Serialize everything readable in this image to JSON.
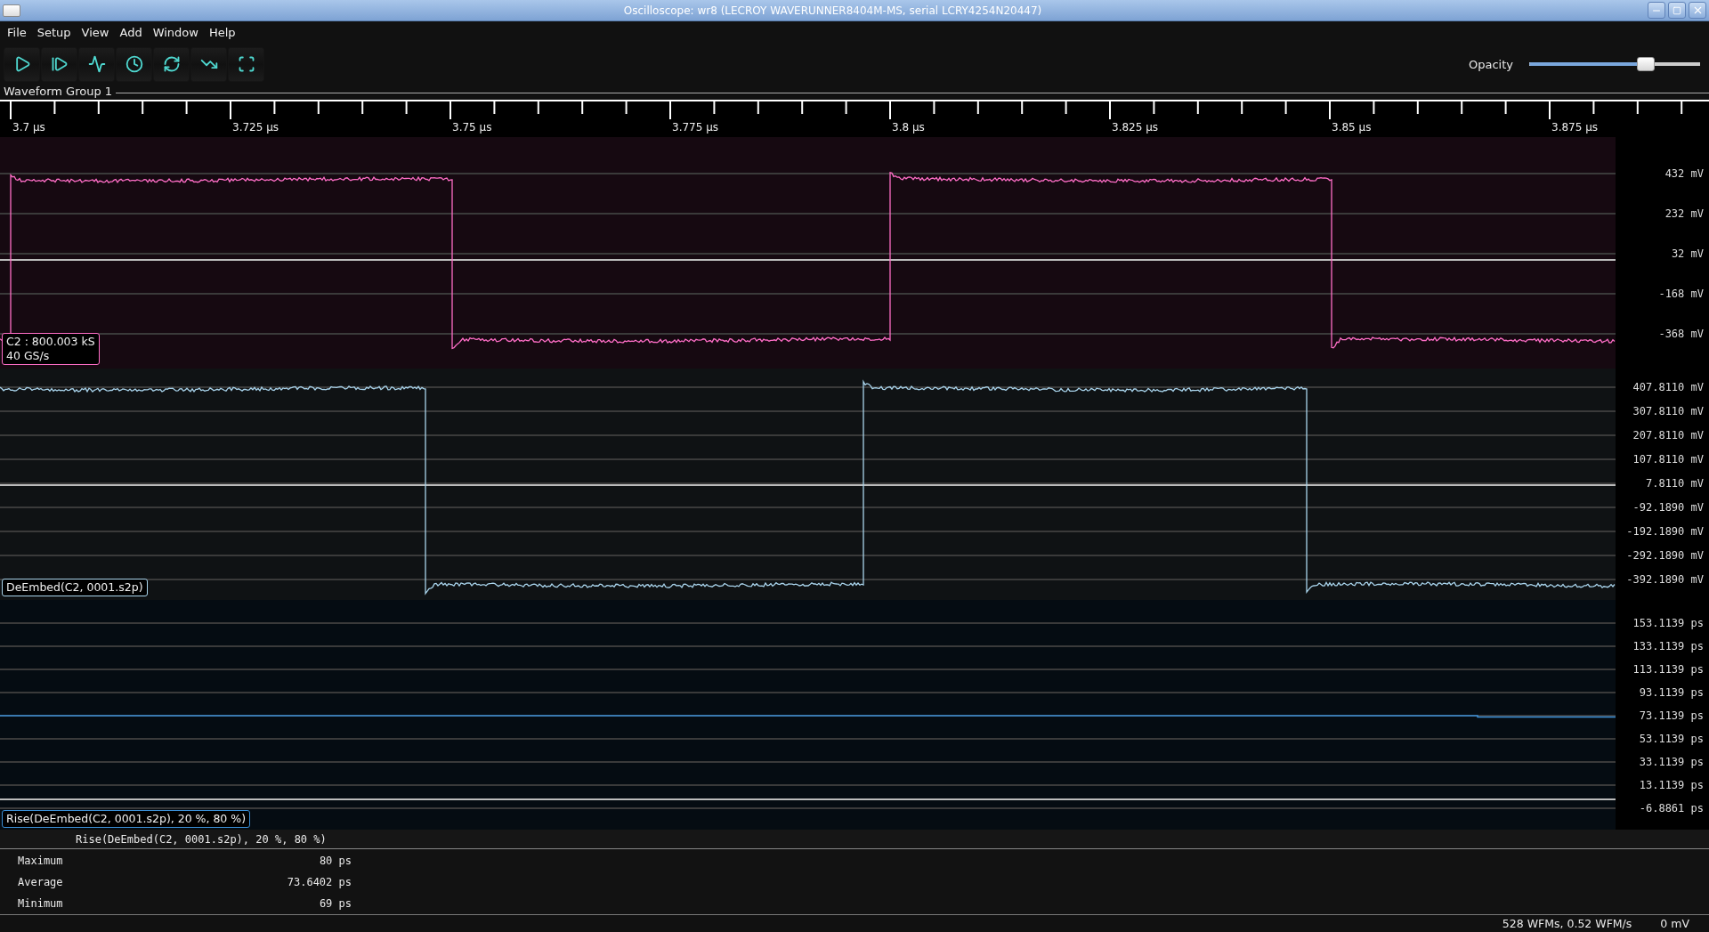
{
  "window": {
    "title": "Oscilloscope: wr8 (LECROY WAVERUNNER8404M-MS, serial LCRY4254N20447)"
  },
  "menu": [
    "File",
    "Setup",
    "View",
    "Add",
    "Window",
    "Help"
  ],
  "opacity": {
    "label": "Opacity",
    "level": 0.68
  },
  "group": {
    "title": "Waveform Group 1",
    "time_ticks": [
      "3.7 µs",
      "3.725 µs",
      "3.75 µs",
      "3.775 µs",
      "3.8 µs",
      "3.825 µs",
      "3.85 µs",
      "3.875 µs"
    ]
  },
  "panels": [
    {
      "kind": "square",
      "color": "#ff6ec7",
      "labels": [
        "C2 : 800.003 kS",
        "40 GS/s"
      ],
      "axis_labels": [
        "432 mV",
        "232 mV",
        "32 mV",
        "-168 mV",
        "-368 mV"
      ]
    },
    {
      "kind": "square_late",
      "color": "#a9d4ec",
      "labels": [
        "DeEmbed(C2, 0001.s2p)"
      ],
      "axis_labels": [
        "407.8110 mV",
        "307.8110 mV",
        "207.8110 mV",
        "107.8110 mV",
        "7.8110 mV",
        "-92.1890 mV",
        "-192.1890 mV",
        "-292.1890 mV",
        "-392.1890 mV"
      ]
    },
    {
      "kind": "trend",
      "color": "#3b8fd6",
      "labels": [
        "Rise(DeEmbed(C2, 0001.s2p), 20 %, 80 %)"
      ],
      "axis_labels": [
        "153.1139 ps",
        "133.1139 ps",
        "113.1139 ps",
        "93.1139 ps",
        "73.1139 ps",
        "53.1139 ps",
        "33.1139 ps",
        "13.1139 ps",
        "-6.8861 ps"
      ]
    }
  ],
  "measurements": {
    "heading": "Rise(DeEmbed(C2, 0001.s2p), 20 %, 80 %)",
    "rows": [
      {
        "name": "Maximum",
        "value": "80 ps"
      },
      {
        "name": "Average",
        "value": "73.6402 ps"
      },
      {
        "name": "Minimum",
        "value": "69 ps"
      }
    ]
  },
  "status_bar": {
    "rate": "528 WFMs, 0.52 WFM/s",
    "reading": "0 mV"
  }
}
